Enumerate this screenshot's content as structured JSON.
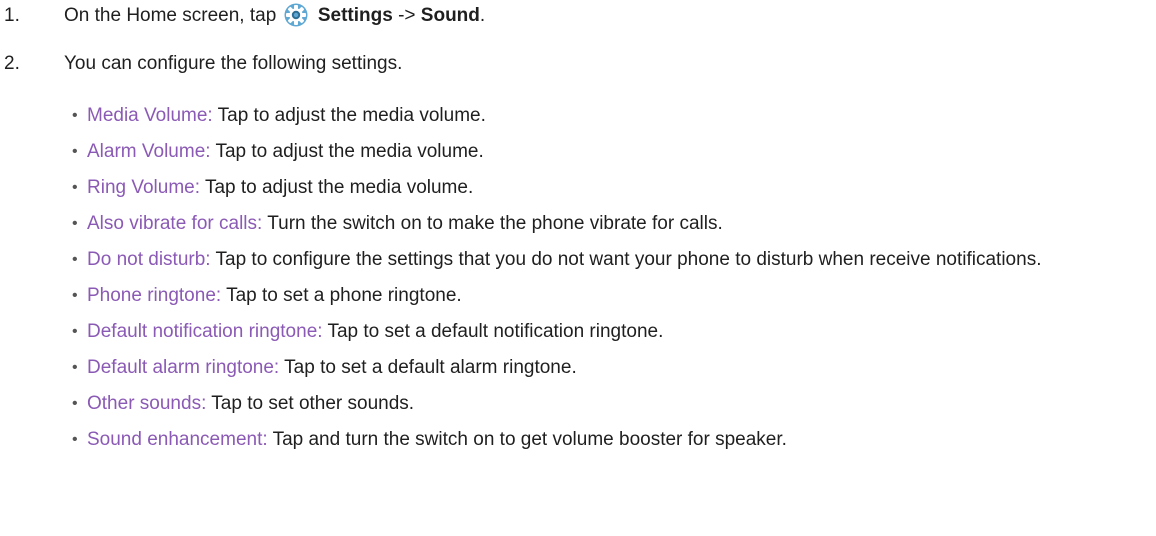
{
  "steps": [
    {
      "number": "1.",
      "text_before": "On the Home screen, tap",
      "icon": "settings-gear-icon",
      "bold1": "Settings",
      "arrow": "->",
      "bold2": "Sound",
      "end": "."
    },
    {
      "number": "2.",
      "text": "You can configure the following settings."
    }
  ],
  "bullets": [
    {
      "term": "Media Volume:",
      "desc": "Tap to adjust the media volume."
    },
    {
      "term": "Alarm Volume:",
      "desc": "Tap to adjust the media volume."
    },
    {
      "term": "Ring Volume:",
      "desc": "Tap to adjust the media volume."
    },
    {
      "term": "Also vibrate for calls:",
      "desc": "Turn the switch on to make the phone vibrate for calls."
    },
    {
      "term": "Do not disturb:",
      "desc": "Tap to configure the settings that you do not want your phone to disturb when receive notifications."
    },
    {
      "term": "Phone ringtone:",
      "desc": "Tap to set a phone ringtone."
    },
    {
      "term": "Default notification ringtone:",
      "desc": "Tap to set a default notification ringtone."
    },
    {
      "term": "Default alarm ringtone:",
      "desc": "Tap to set a default alarm ringtone."
    },
    {
      "term": "Other sounds:",
      "desc": "Tap to set other sounds."
    },
    {
      "term": "Sound enhancement:",
      "desc": "Tap and turn the switch on to get volume booster for speaker."
    }
  ],
  "colors": {
    "term": "#8b5ab5",
    "gear_outer": "#5fa8d3",
    "gear_inner": "#2f6f96"
  }
}
